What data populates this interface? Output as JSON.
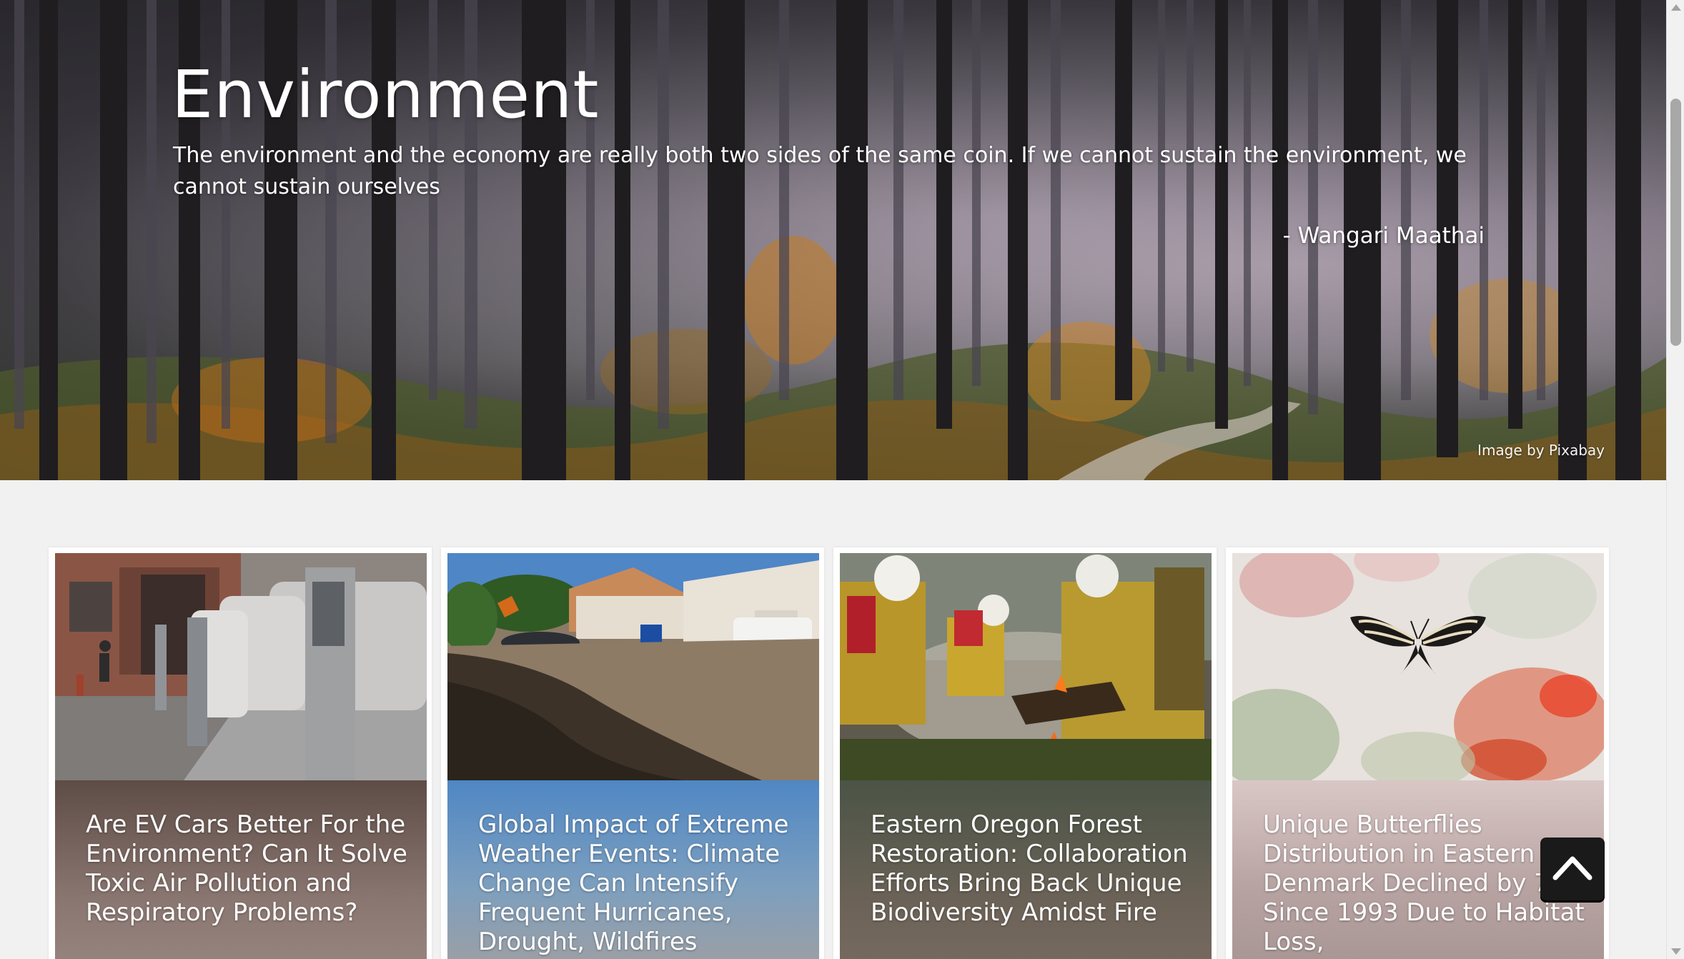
{
  "hero": {
    "title": "Environment",
    "quote": "The environment and the economy are really both two sides of the same coin. If we cannot sustain the environment, we cannot sustain ourselves",
    "author": "- Wangari Maathai",
    "image_credit": "Image by Pixabay"
  },
  "cards": [
    {
      "title": "Are EV Cars Better For the Environment? Can It Solve Toxic Air Pollution and Respiratory Problems?"
    },
    {
      "title": "Global Impact of Extreme Weather Events: Climate Change Can Intensify Frequent Hurricanes, Drought, Wildfires"
    },
    {
      "title": "Eastern Oregon Forest Restoration: Collaboration Efforts Bring Back Unique Biodiversity Amidst Fire"
    },
    {
      "title": "Unique Butterflies Distribution in Eastern Denmark Declined by 72% Since 1993 Due to Habitat Loss,"
    }
  ],
  "icons": {
    "back_to_top": "chevron-up-icon"
  },
  "colors": {
    "page_background": "#f1f1f1",
    "card_background": "#ffffff",
    "back_to_top_background": "#1a1a1a",
    "hero_text": "#ffffff"
  }
}
